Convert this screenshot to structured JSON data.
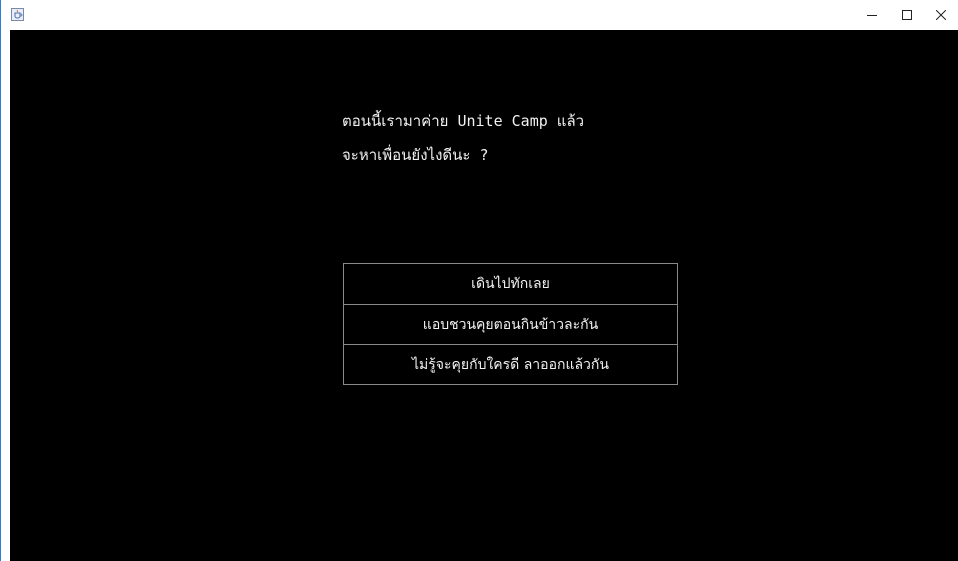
{
  "window": {
    "icon": "java-cup-icon",
    "controls": {
      "minimize": "–",
      "maximize": "☐",
      "close": "✕"
    }
  },
  "story": {
    "line1": "ตอนนี้เรามาค่าย Unite Camp แล้ว",
    "line2": "จะหาเพื่อนยังไงดีนะ ?"
  },
  "choices": [
    {
      "label": "เดินไปทักเลย"
    },
    {
      "label": "แอบชวนคุยตอนกินข้าวละกัน"
    },
    {
      "label": "ไม่รู้จะคุยกับใครดี ลาออกแล้วกัน"
    }
  ],
  "colors": {
    "background": "#000000",
    "text": "#f2f2f2",
    "button_border": "#8a8a8a"
  }
}
